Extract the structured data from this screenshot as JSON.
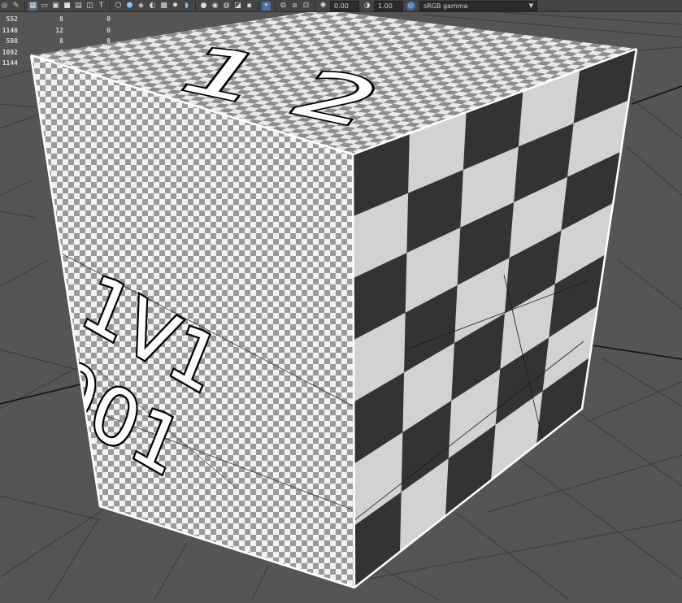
{
  "toolbar": {
    "exposure_value": "0.00",
    "gamma_value": "1.00",
    "color_space": "sRGB gamma",
    "icons": [
      "select-tool-icon",
      "paint-tool-icon",
      "grid-icon",
      "film-gate-icon",
      "resolution-gate-icon",
      "camera-icon",
      "safe-area-icon",
      "xray-icon",
      "image-plane-icon",
      "isolate-icon",
      "wireframe-icon",
      "smooth-shade-icon",
      "textured-icon",
      "lighting-icon",
      "shadows-icon",
      "ambient-occlusion-icon",
      "motion-blur-icon",
      "antialias-icon",
      "depth-of-field-icon",
      "hud-icon",
      "isolate-select-icon",
      "xray-joints-icon",
      "exposure-icon",
      "gamma-icon",
      "view-transform-icon"
    ]
  },
  "hud": {
    "rows": [
      [
        "",
        "552",
        "8",
        "0"
      ],
      [
        "",
        "1148",
        "12",
        "0"
      ],
      [
        "",
        "598",
        "8",
        "0"
      ],
      [
        "",
        "1092",
        "8",
        "0"
      ],
      [
        "",
        "1144",
        "24",
        "0"
      ]
    ]
  },
  "uv_labels": {
    "top": "1 2",
    "left_row1": "1V1",
    "left_row2": "001"
  },
  "colors": {
    "viewport_bg": "#555555",
    "checker_dark": "#333333",
    "checker_light": "#d2d2d2",
    "checker_fine_dark": "#9a9a9a",
    "checker_fine_light": "#f2f2f2",
    "grid_line": "#3f3f3f",
    "axis_line": "#111111"
  }
}
